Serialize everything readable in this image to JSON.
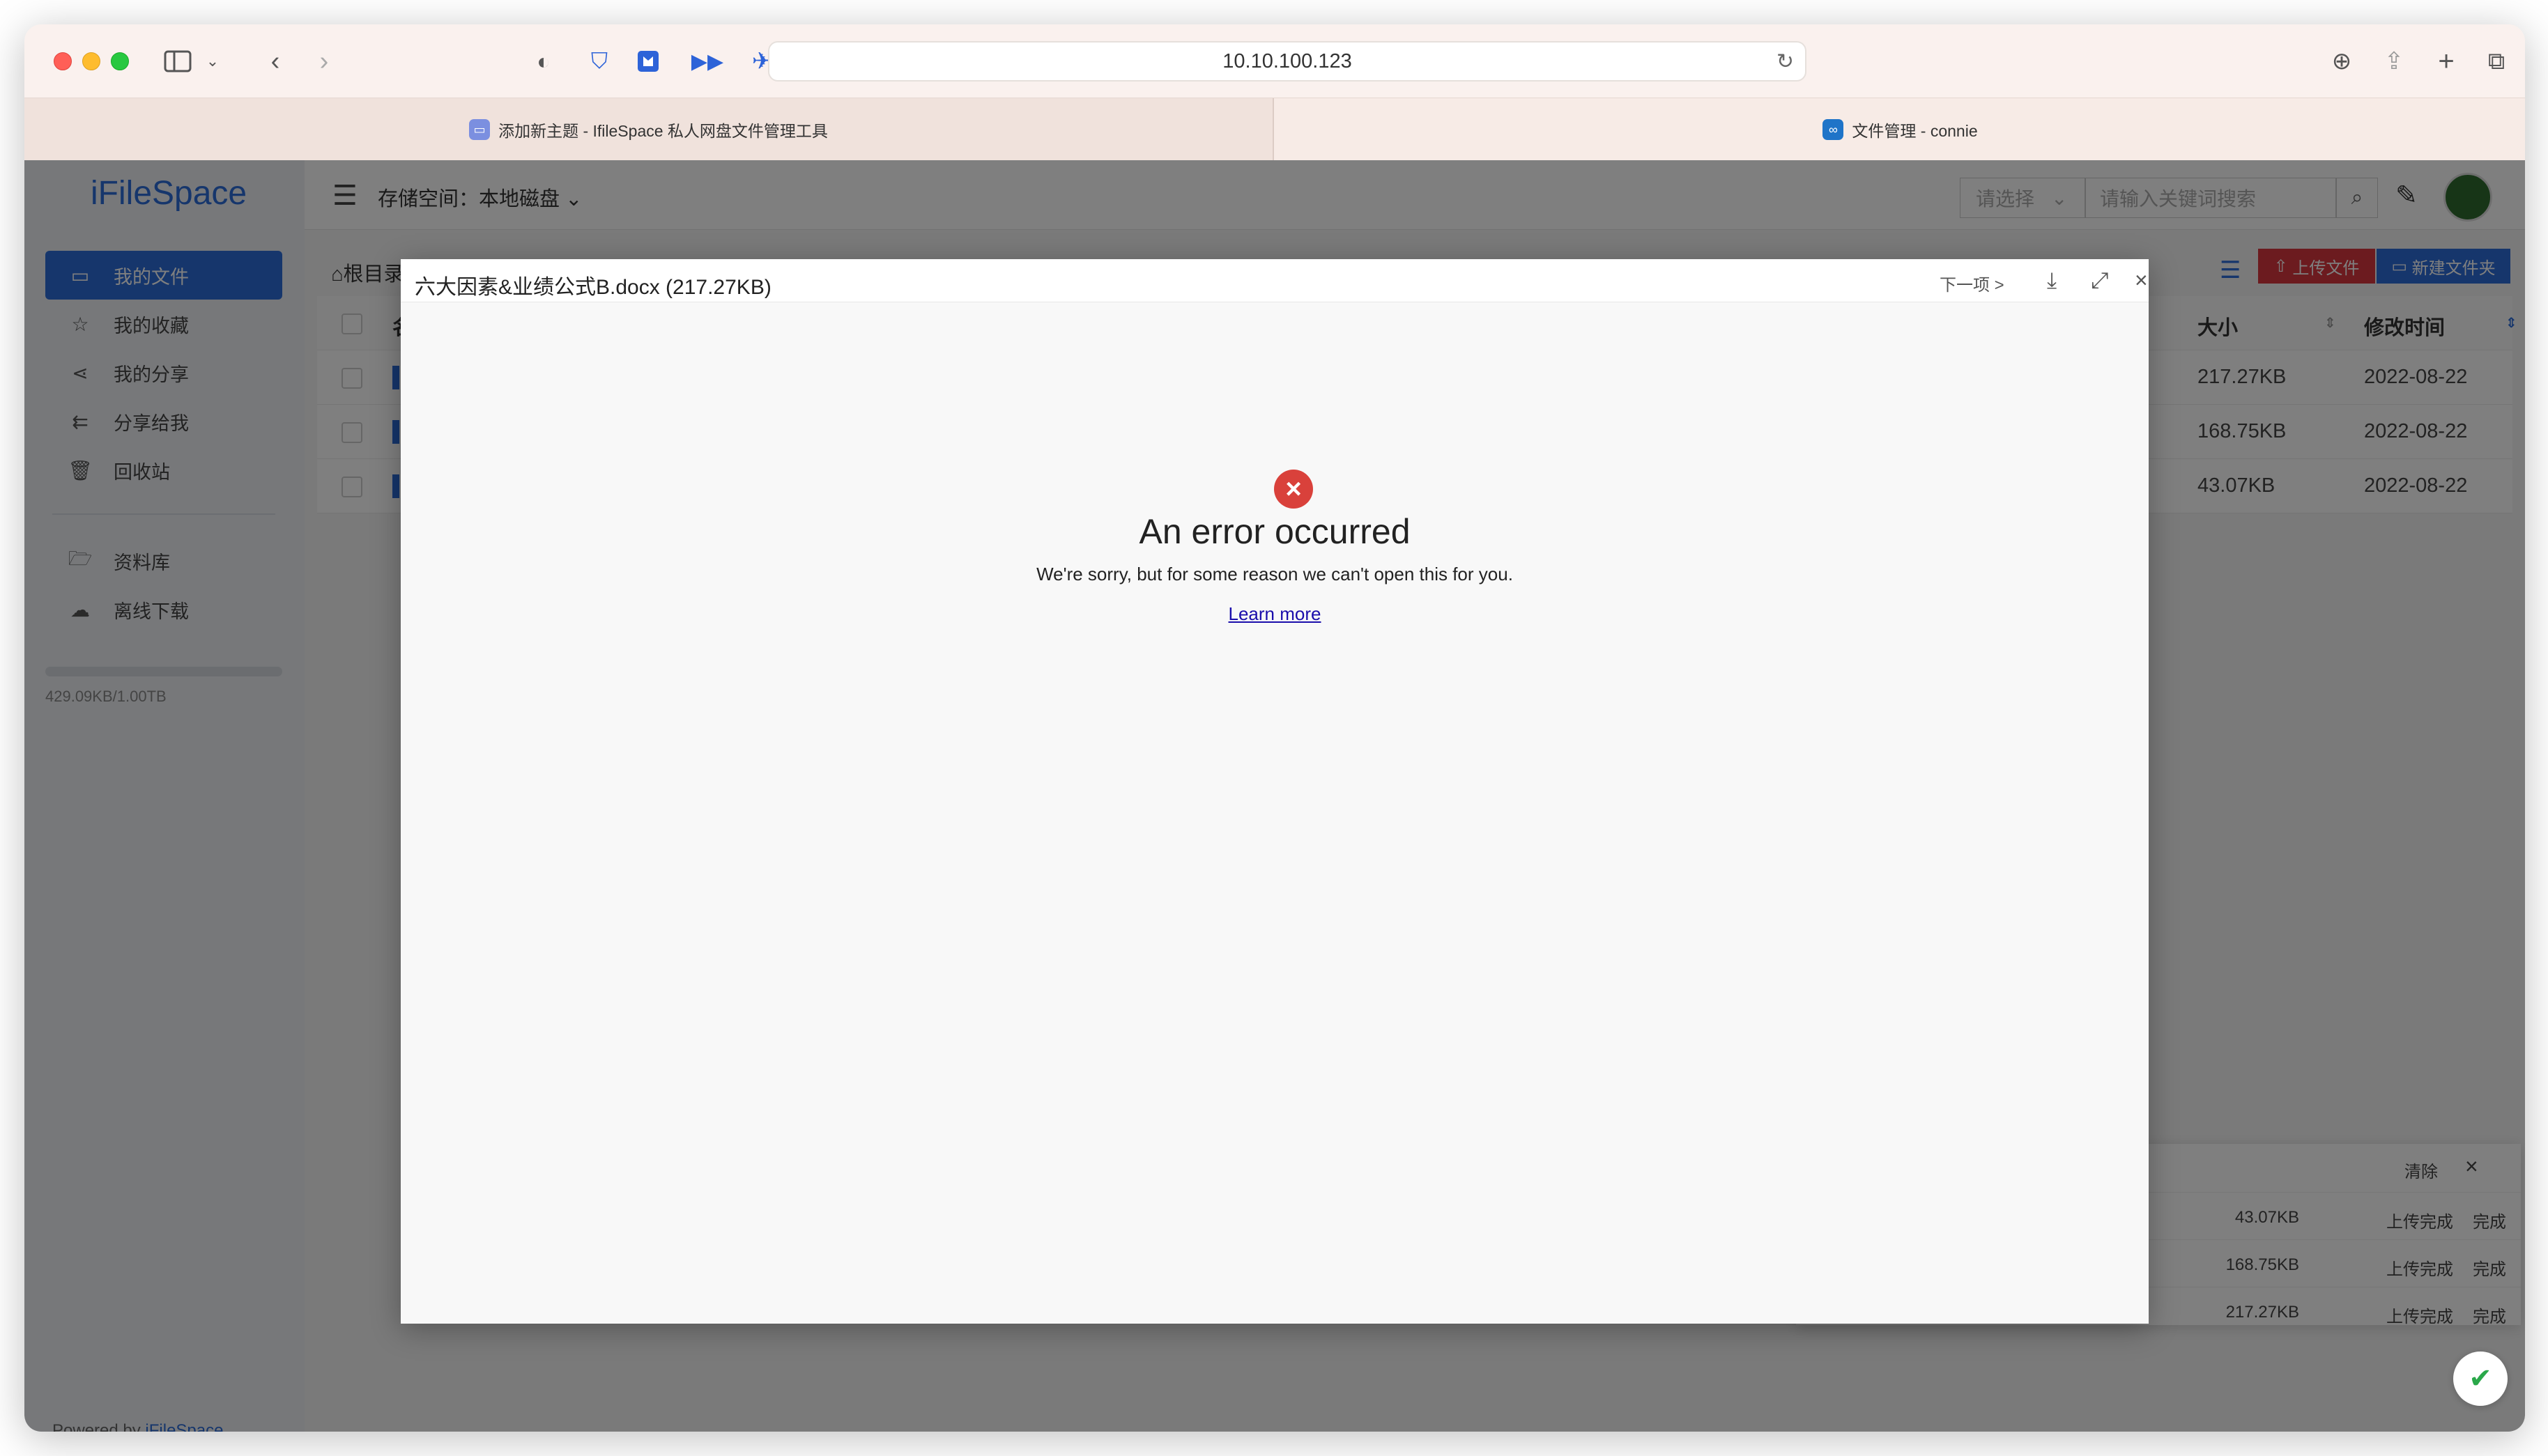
{
  "browser": {
    "url": "10.10.100.123",
    "tabs": [
      {
        "title": "添加新主题 - IfileSpace 私人网盘文件管理工具"
      },
      {
        "title": "文件管理 - connie"
      }
    ]
  },
  "sidebar": {
    "brand": "iFileSpace",
    "items": [
      {
        "label": "我的文件",
        "icon": "folder-icon"
      },
      {
        "label": "我的收藏",
        "icon": "star-icon"
      },
      {
        "label": "我的分享",
        "icon": "share-icon"
      },
      {
        "label": "分享给我",
        "icon": "shared-to-me-icon"
      },
      {
        "label": "回收站",
        "icon": "trash-icon"
      },
      {
        "label": "资料库",
        "icon": "library-icon"
      },
      {
        "label": "离线下载",
        "icon": "cloud-download-icon"
      }
    ],
    "quota": "429.09KB/1.00TB",
    "powered_prefix": "Powered by ",
    "powered_brand": "iFileSpace"
  },
  "header": {
    "storage_label": "存储空间：",
    "storage_value": "本地磁盘",
    "select_placeholder": "请选择",
    "search_placeholder": "请输入关键词搜索"
  },
  "content": {
    "breadcrumb": "根目录",
    "upload_button": "上传文件",
    "new_folder_button": "新建文件夹",
    "columns": {
      "name": "名称",
      "size": "大小",
      "modified": "修改时间"
    },
    "rows": [
      {
        "size": "217.27KB",
        "modified": "2022-08-22"
      },
      {
        "size": "168.75KB",
        "modified": "2022-08-22"
      },
      {
        "size": "43.07KB",
        "modified": "2022-08-22"
      }
    ]
  },
  "upload_panel": {
    "clear_label": "清除",
    "rows": [
      {
        "size": "43.07KB",
        "status": "上传完成",
        "done": "完成"
      },
      {
        "size": "168.75KB",
        "status": "上传完成",
        "done": "完成"
      },
      {
        "size": "217.27KB",
        "status": "上传完成",
        "done": "完成"
      }
    ]
  },
  "preview": {
    "title": "六大因素&业绩公式B.docx (217.27KB)",
    "next_label": "下一项 >",
    "error_title": "An error occurred",
    "error_message": "We're sorry, but for some reason we can't open this for you.",
    "learn_more": "Learn more"
  },
  "colors": {
    "accent": "#2c6dd8",
    "danger": "#d9363e",
    "error_icon": "#d9413b"
  }
}
